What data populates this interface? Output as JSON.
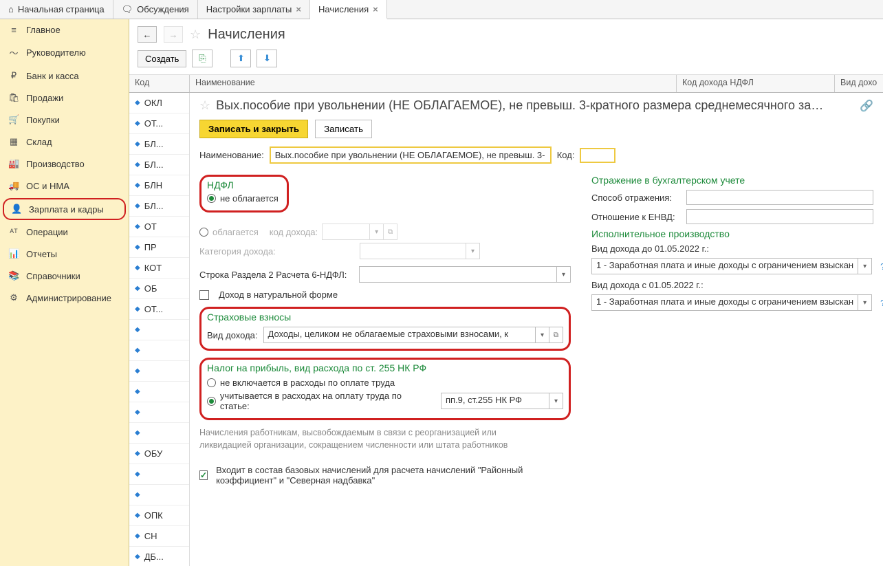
{
  "tabs": [
    {
      "icon": "⌂",
      "label": "Начальная страница",
      "closable": false
    },
    {
      "icon": "🗨",
      "label": "Обсуждения",
      "closable": false
    },
    {
      "icon": "",
      "label": "Настройки зарплаты",
      "closable": true
    },
    {
      "icon": "",
      "label": "Начисления",
      "closable": true,
      "active": true
    }
  ],
  "sidebar": [
    {
      "icon": "≡",
      "label": "Главное"
    },
    {
      "icon": "〜",
      "label": "Руководителю"
    },
    {
      "icon": "₽",
      "label": "Банк и касса"
    },
    {
      "icon": "🛍",
      "label": "Продажи"
    },
    {
      "icon": "🛒",
      "label": "Покупки"
    },
    {
      "icon": "▦",
      "label": "Склад"
    },
    {
      "icon": "🏭",
      "label": "Производство"
    },
    {
      "icon": "🚚",
      "label": "ОС и НМА"
    },
    {
      "icon": "👤",
      "label": "Зарплата и кадры",
      "active": true
    },
    {
      "icon": "ᴬᵀ",
      "label": "Операции"
    },
    {
      "icon": "📊",
      "label": "Отчеты"
    },
    {
      "icon": "📚",
      "label": "Справочники"
    },
    {
      "icon": "⚙",
      "label": "Администрирование"
    }
  ],
  "page_title": "Начисления",
  "toolbar": {
    "create": "Создать"
  },
  "columns": {
    "c1": "Код",
    "c2": "Наименование",
    "c3": "Код дохода НДФЛ",
    "c4": "Вид дохо"
  },
  "codes": [
    "ОКЛ",
    "ОТ...",
    "БЛ...",
    "БЛ...",
    "БЛН",
    "БЛ...",
    "ОТ",
    "ПР",
    "КОТ",
    "ОБ",
    "ОТ...",
    "",
    "",
    "",
    "",
    "",
    "",
    "ОБУ",
    "",
    "",
    "ОПК",
    "СН",
    "ДБ..."
  ],
  "detail": {
    "title": "Вых.пособие при увольнении (НЕ ОБЛАГАЕМОЕ), не превыш. 3-кратного размера среднемесячного за…",
    "save_close": "Записать и закрыть",
    "save": "Записать",
    "name_label": "Наименование:",
    "name_value": "Вых.пособие при увольнении (НЕ ОБЛАГАЕМОЕ), не превыш. 3-",
    "code_label": "Код:",
    "ndfl_title": "НДФЛ",
    "ndfl_not": "не облагается",
    "ndfl_yes": "облагается",
    "income_code_label": "код дохода:",
    "category_label": "Категория дохода:",
    "line6_label": "Строка Раздела 2 Расчета 6-НДФЛ:",
    "natural_label": "Доход в натуральной форме",
    "insurance_title": "Страховые взносы",
    "income_type_label": "Вид дохода:",
    "income_type_value": "Доходы, целиком не облагаемые страховыми взносами, к",
    "tax_title": "Налог на прибыль, вид расхода по ст. 255 НК РФ",
    "tax_not": "не включается в расходы по оплате труда",
    "tax_yes": "учитывается в расходах на оплату труда по статье:",
    "tax_article": "пп.9, ст.255 НК РФ",
    "hint_text": "Начисления работникам, высвобождаемым в связи с реорганизацией или ликвидацией организации, сокращением численности или штата работников",
    "footer_checkbox": "Входит в состав базовых начислений для расчета начислений \"Районный коэффициент\" и \"Северная надбавка\""
  },
  "right": {
    "acc_title": "Отражение в бухгалтерском учете",
    "method_label": "Способ отражения:",
    "envd_label": "Отношение к ЕНВД:",
    "exec_title": "Исполнительное производство",
    "before_label": "Вид дохода до 01.05.2022 г.:",
    "after_label": "Вид дохода с 01.05.2022 г.:",
    "value": "1 - Заработная плата и иные доходы с ограничением взыскан"
  }
}
